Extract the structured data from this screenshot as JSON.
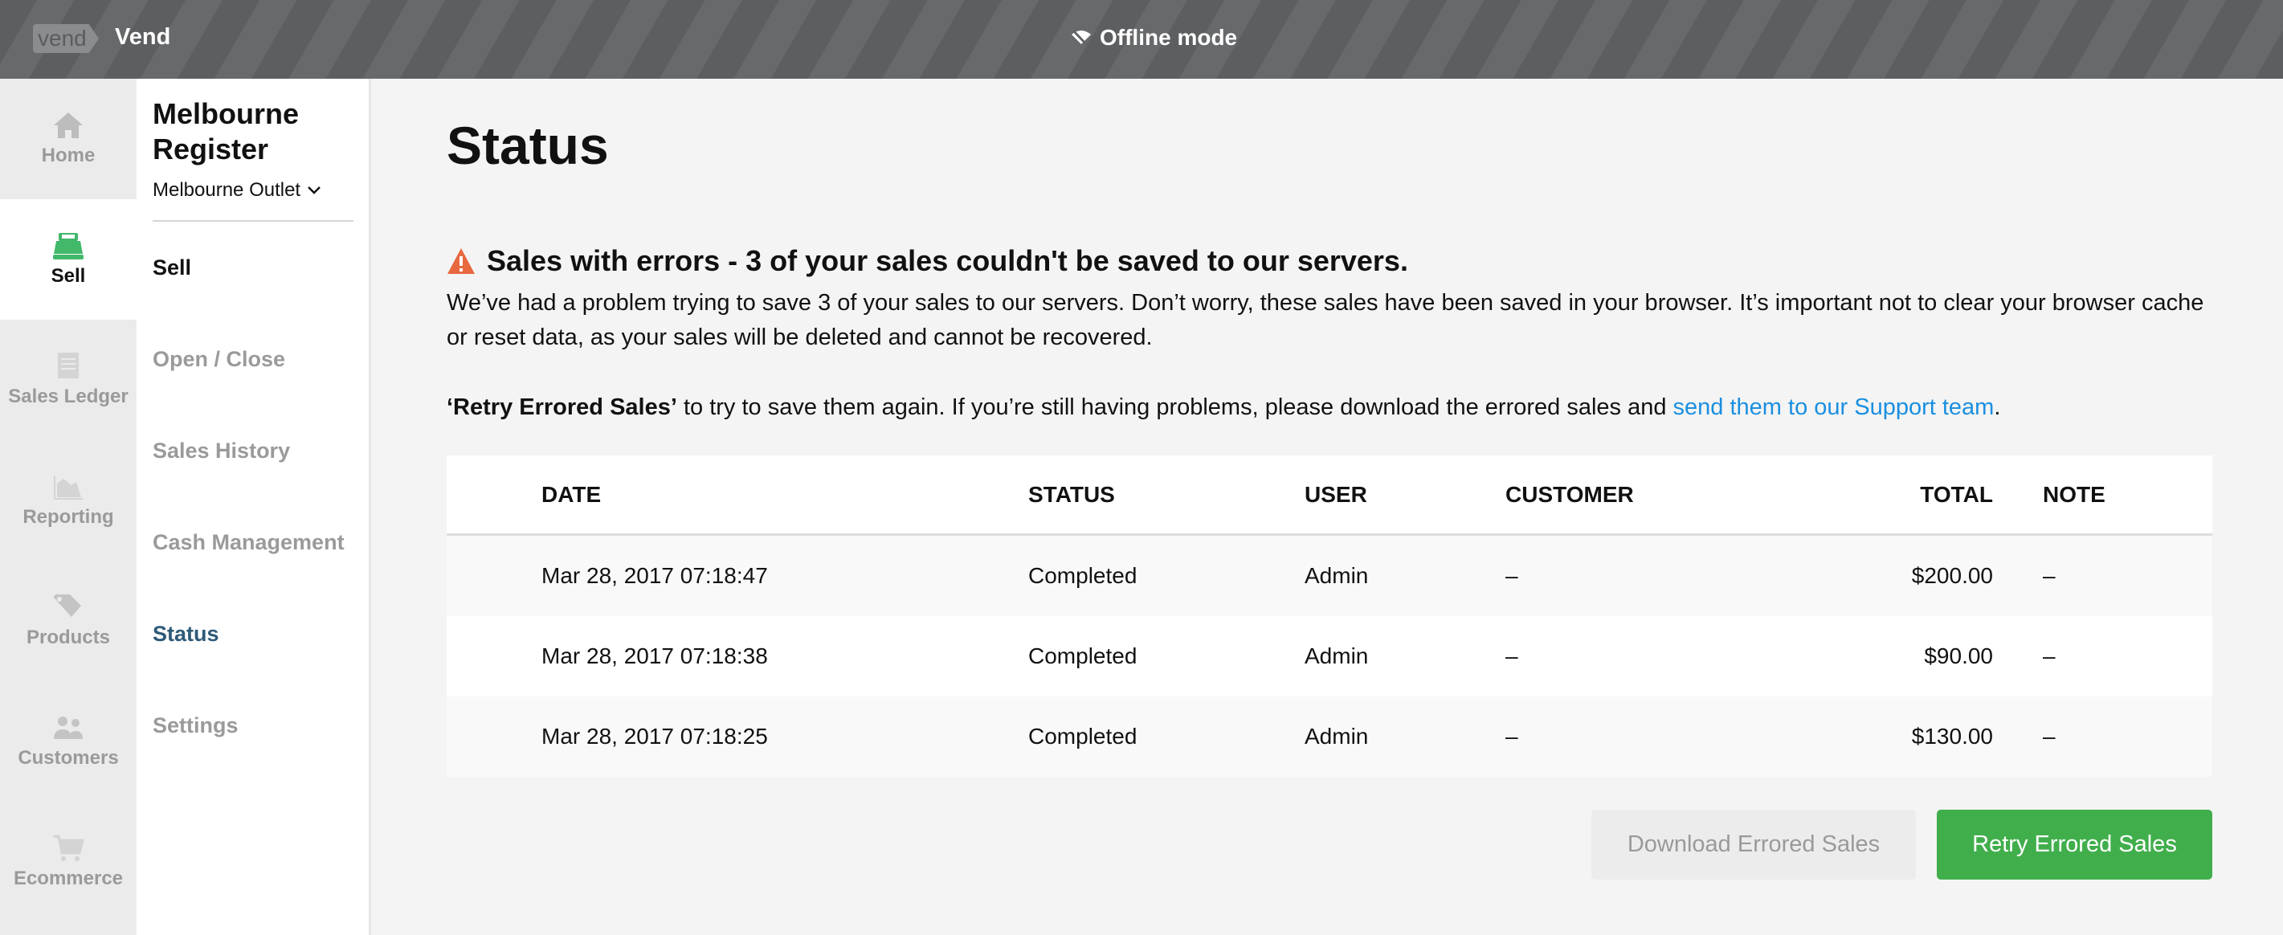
{
  "topbar": {
    "logo_text": "vend",
    "brand": "Vend",
    "status": "Offline mode"
  },
  "rail": [
    {
      "label": "Home",
      "icon": "home-icon"
    },
    {
      "label": "Sell",
      "icon": "register-icon"
    },
    {
      "label": "Sales Ledger",
      "icon": "receipt-icon"
    },
    {
      "label": "Reporting",
      "icon": "chart-icon"
    },
    {
      "label": "Products",
      "icon": "tag-icon"
    },
    {
      "label": "Customers",
      "icon": "users-icon"
    },
    {
      "label": "Ecommerce",
      "icon": "cart-icon"
    }
  ],
  "subnav": {
    "register": "Melbourne Register",
    "outlet": "Melbourne Outlet",
    "items": [
      "Sell",
      "Open / Close",
      "Sales History",
      "Cash Management",
      "Status",
      "Settings"
    ]
  },
  "main": {
    "title": "Status",
    "warning": "Sales with errors - 3 of your sales couldn't be saved to our servers.",
    "paragraph": "We’ve had a problem trying to save 3 of your sales to our servers. Don’t worry, these sales have been saved in your browser. It’s important not to clear your browser cache or reset data, as your sales will be deleted and cannot be recovered.",
    "retry_bold": "‘Retry Errored Sales’",
    "retry_text": " to try to save them again. If you’re still having problems, please download the errored sales and ",
    "support_link": "send them to our Support team",
    "period": ".",
    "columns": [
      "DATE",
      "STATUS",
      "USER",
      "CUSTOMER",
      "TOTAL",
      "NOTE"
    ],
    "rows": [
      [
        "Mar 28, 2017 07:18:47",
        "Completed",
        "Admin",
        "–",
        "$200.00",
        "–"
      ],
      [
        "Mar 28, 2017 07:18:38",
        "Completed",
        "Admin",
        "–",
        "$90.00",
        "–"
      ],
      [
        "Mar 28, 2017 07:18:25",
        "Completed",
        "Admin",
        "–",
        "$130.00",
        "–"
      ]
    ],
    "download_button": "Download Errored Sales",
    "retry_button": "Retry Errored Sales"
  },
  "colors": {
    "accent": "#41ae4c",
    "link": "#1a8fe0",
    "warning": "#e8683f",
    "active_nav": "#2e5a78"
  }
}
